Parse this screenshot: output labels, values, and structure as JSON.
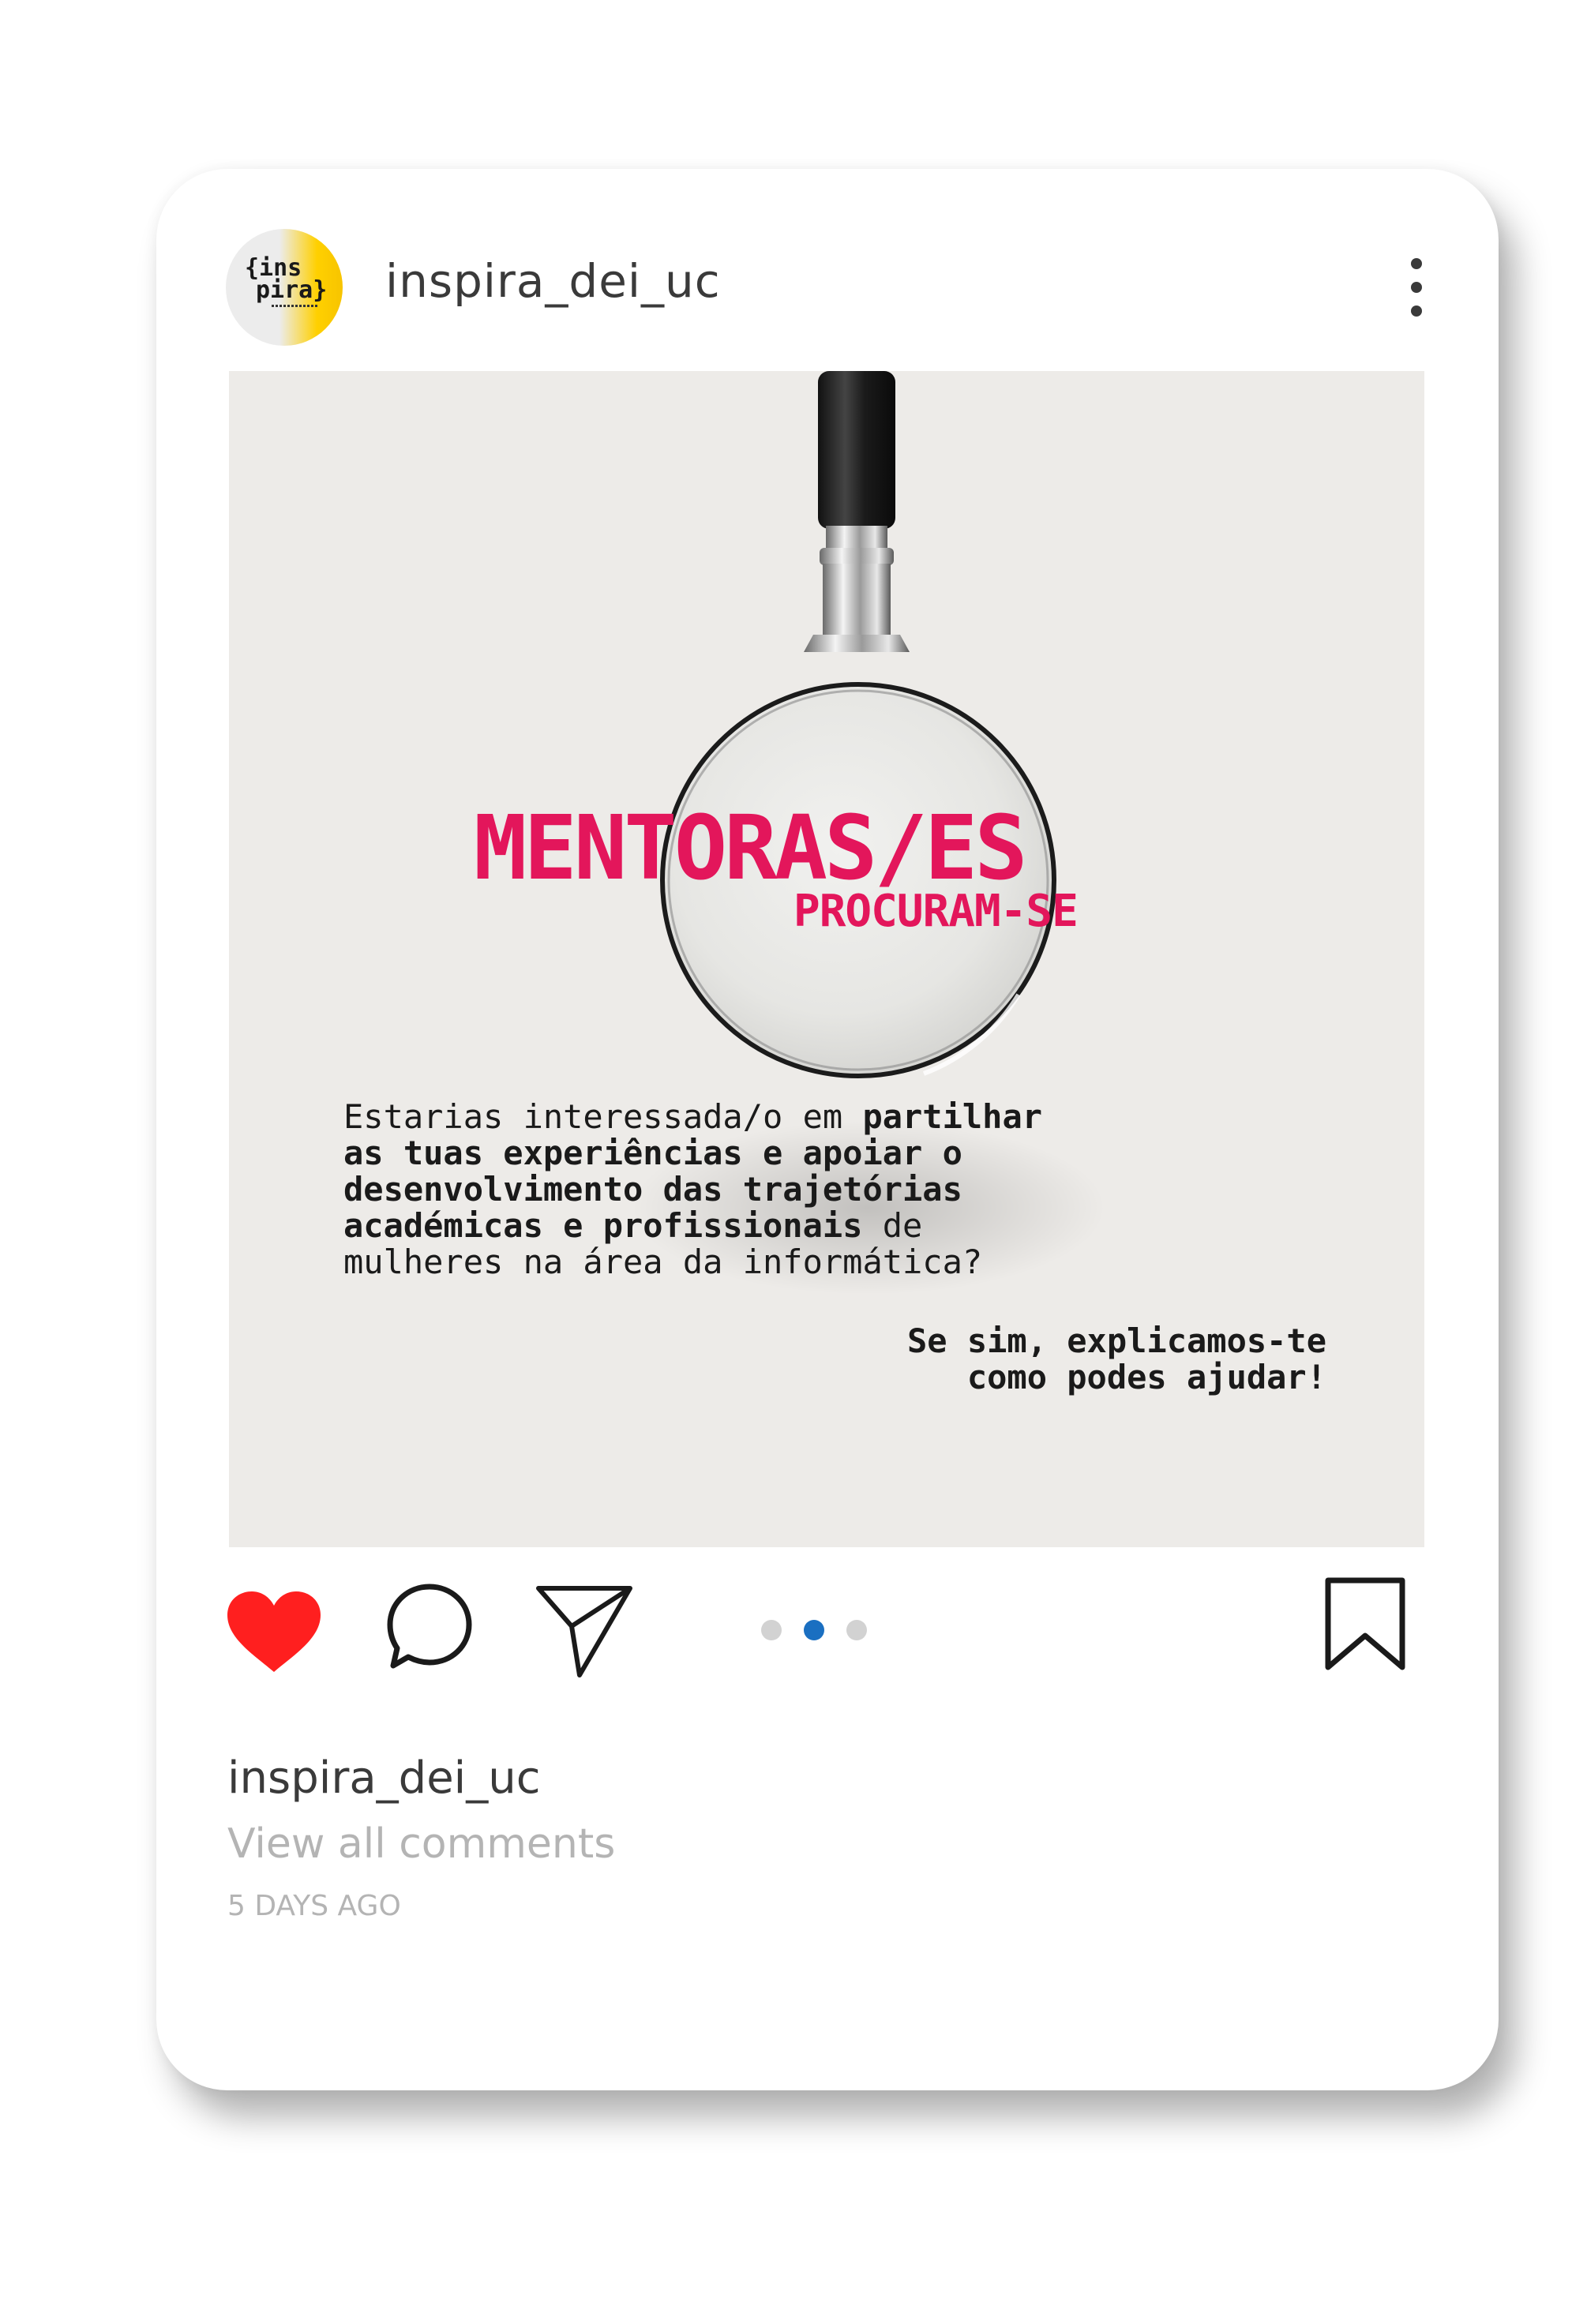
{
  "header": {
    "username": "inspira_dei_uc",
    "avatar_logo_line1": "{ins",
    "avatar_logo_line2": "pira}",
    "more_icon": "more-vertical-icon"
  },
  "post": {
    "headline": "MENTORAS/ES",
    "subheadline": "PROCURAM-SE",
    "body_parts": [
      "Estarias interessada/o em ",
      "partilhar as tuas experiências e apoiar o desenvolvimento das trajetórias académicas e profissionais",
      " de mulheres na área da informática?"
    ],
    "cta_line1": "Se sim, explicamos-te",
    "cta_line2": "como podes ajudar!",
    "headline_color": "#e3165b",
    "background_color": "#edebe8"
  },
  "actions": {
    "like_icon": "heart-icon",
    "comment_icon": "comment-icon",
    "share_icon": "send-icon",
    "save_icon": "bookmark-icon",
    "like_color": "#ff1f1f",
    "carousel": {
      "total": 3,
      "active_index": 1,
      "active_color": "#1a6fc1"
    }
  },
  "caption": {
    "username": "inspira_dei_uc",
    "view_comments": "View all comments",
    "timestamp": "5 DAYS AGO"
  }
}
